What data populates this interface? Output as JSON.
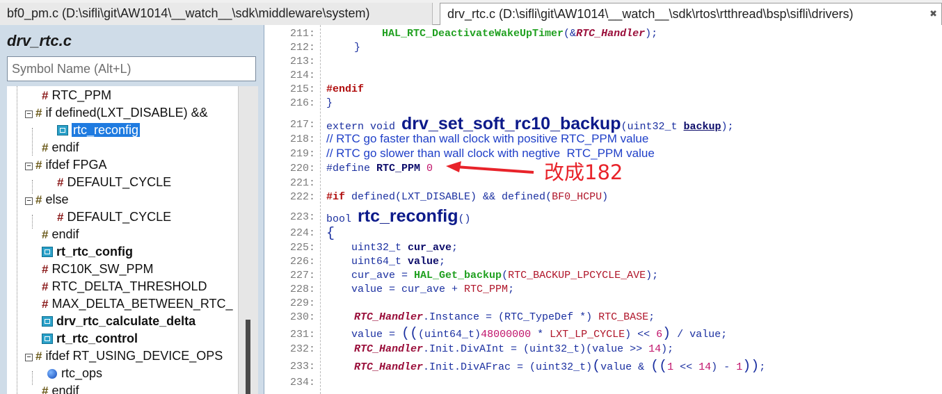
{
  "tabs": [
    {
      "label": "bf0_pm.c (D:\\sifli\\git\\AW1014\\__watch__\\sdk\\middleware\\system)"
    },
    {
      "label": "drv_rtc.c (D:\\sifli\\git\\AW1014\\__watch__\\sdk\\rtos\\rtthread\\bsp\\sifli\\drivers)",
      "close": "✖"
    }
  ],
  "symbols": {
    "file_title": "drv_rtc.c",
    "search_placeholder": "Symbol Name (Alt+L)",
    "items": [
      {
        "label": "RTC_PPM"
      },
      {
        "label": "if defined(LXT_DISABLE) &&"
      },
      {
        "label": "rtc_reconfig"
      },
      {
        "label": "endif"
      },
      {
        "label": "ifdef FPGA"
      },
      {
        "label": "DEFAULT_CYCLE"
      },
      {
        "label": "else"
      },
      {
        "label": "DEFAULT_CYCLE"
      },
      {
        "label": "endif"
      },
      {
        "label": "rt_rtc_config"
      },
      {
        "label": "RC10K_SW_PPM"
      },
      {
        "label": "RTC_DELTA_THRESHOLD"
      },
      {
        "label": "MAX_DELTA_BETWEEN_RTC_"
      },
      {
        "label": "drv_rtc_calculate_delta"
      },
      {
        "label": "rt_rtc_control"
      },
      {
        "label": "ifdef RT_USING_DEVICE_OPS"
      },
      {
        "label": "rtc_ops"
      },
      {
        "label": "endif"
      }
    ]
  },
  "code": {
    "line_numbers": [
      "211:",
      "212:",
      "213:",
      "214:",
      "215:",
      "216:",
      "217:",
      "218:",
      "219:",
      "220:",
      "221:",
      "222:",
      "223:",
      "224:",
      "225:",
      "226:",
      "227:",
      "228:",
      "229:",
      "230:",
      "231:",
      "232:",
      "233:",
      "234:"
    ],
    "l211": {
      "call": "HAL_RTC_DeactivateWakeUpTimer",
      "open": "(&",
      "arg": "RTC_Handler",
      "close": ");"
    },
    "l212": "}",
    "l215": "#endif",
    "l216": "}",
    "l217": {
      "pre": "extern void ",
      "fn": "drv_set_soft_rc10_backup",
      "open": "(uint32_t ",
      "param": "backup",
      "close": ");"
    },
    "l218": "// RTC go faster than wall clock with positive RTC_PPM value",
    "l219": "// RTC go slower than wall clock with negtive  RTC_PPM value",
    "l220": {
      "pre": "#define ",
      "name": "RTC_PPM",
      "value": "0"
    },
    "l222": {
      "kw": "#if",
      "rest": " defined(LXT_DISABLE) && defined(",
      "mac": "BF0_HCPU",
      "close": ")"
    },
    "l223": {
      "pre": "bool ",
      "fn": "rtc_reconfig",
      "close": "()"
    },
    "l224": "{",
    "l225": {
      "pre": "    uint32_t ",
      "var": "cur_ave",
      "close": ";"
    },
    "l226": {
      "pre": "    uint64_t ",
      "var": "value",
      "close": ";"
    },
    "l227": {
      "pre": "    cur_ave = ",
      "call": "HAL_Get_backup",
      "open": "(",
      "mac": "RTC_BACKUP_LPCYCLE_AVE",
      "close": ");"
    },
    "l228": {
      "pre": "    value = cur_ave + ",
      "mac": "RTC_PPM",
      "close": ";"
    },
    "l230": {
      "glob": "RTC_Handler",
      "rest": ".Instance = (RTC_TypeDef *) ",
      "mac": "RTC_BASE",
      "close": ";"
    },
    "l231": {
      "pre": "    value = ",
      "p1": "((",
      "a": "(uint64_t)",
      "num": "48000000",
      "b": " * ",
      "mac": "LXT_LP_CYCLE",
      "c": ") << ",
      "num2": "6",
      "p2": ")",
      "d": " / value;"
    },
    "l232": {
      "glob": "RTC_Handler",
      "rest": ".Init.DivAInt = (uint32_t)(value >> ",
      "num": "14",
      "close": ");"
    },
    "l233": {
      "glob": "RTC_Handler",
      "rest": ".Init.DivAFrac = (uint32_t)",
      "p1": "(",
      "a": "value & ",
      "p2": "((",
      "num": "1",
      "b": " << ",
      "num2": "14",
      "c": ") - ",
      "num3": "1",
      "p3": "))",
      "close": ";"
    }
  },
  "annotation": {
    "text": "改成182",
    "color": "#e8232a"
  }
}
